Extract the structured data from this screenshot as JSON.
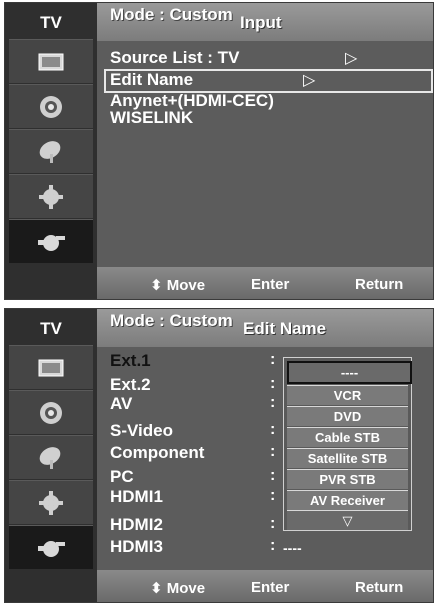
{
  "screen1": {
    "side_title": "TV",
    "mode_text": "Mode : Custom",
    "title": "Input",
    "menu": [
      {
        "label": "Source List : TV",
        "arrow": "▷"
      },
      {
        "label": "Edit Name",
        "arrow": "▷"
      },
      {
        "label": "Anynet+(HDMI-CEC)"
      },
      {
        "label": "WISELINK"
      }
    ],
    "hints": {
      "move": "Move",
      "enter": "Enter",
      "return": "Return"
    }
  },
  "screen2": {
    "side_title": "TV",
    "mode_text": "Mode : Custom",
    "title": "Edit Name",
    "rows": [
      {
        "label": "Ext.1",
        "value": "----"
      },
      {
        "label": "Ext.2",
        "value": ""
      },
      {
        "label": "AV",
        "value": ""
      },
      {
        "label": "S-Video",
        "value": ""
      },
      {
        "label": "Component",
        "value": ""
      },
      {
        "label": "PC",
        "value": ""
      },
      {
        "label": "HDMI1",
        "value": ""
      },
      {
        "label": "HDMI2",
        "value": "----"
      },
      {
        "label": "HDMI3",
        "value": "----"
      }
    ],
    "colon": ":",
    "dropdown": {
      "selected": "----",
      "options": [
        "VCR",
        "DVD",
        "Cable STB",
        "Satellite STB",
        "PVR STB",
        "AV Receiver"
      ],
      "scroll_down": "▽"
    },
    "hints": {
      "move": "Move",
      "enter": "Enter",
      "return": "Return"
    }
  },
  "icons": [
    "picture-icon",
    "sound-icon",
    "channel-icon",
    "setup-icon",
    "input-icon"
  ],
  "colors": {
    "panel": "#5c5c5c",
    "sidebar": "#2f2f2f",
    "text": "#ffffff"
  }
}
